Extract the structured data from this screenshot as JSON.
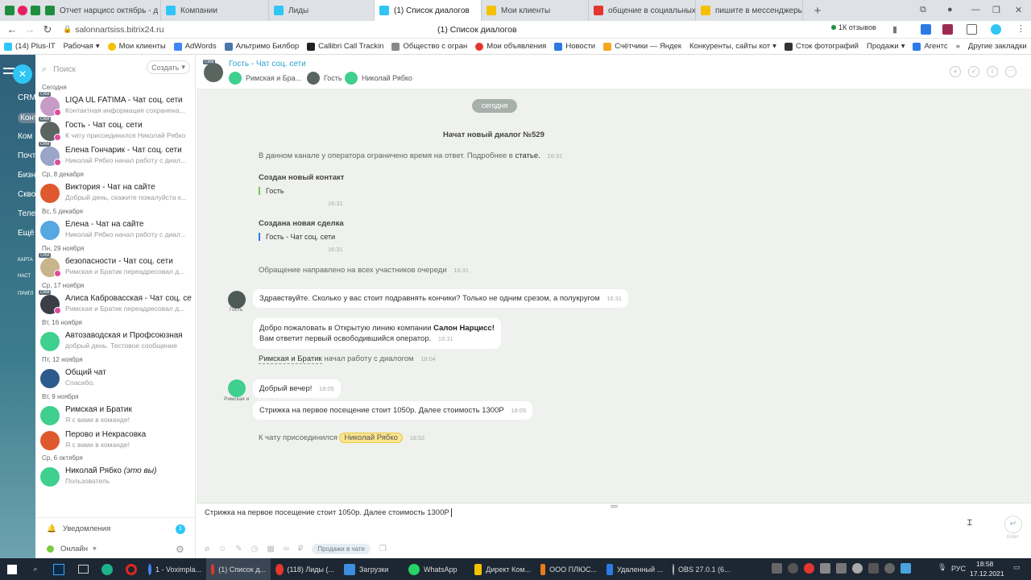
{
  "browser": {
    "tabs": [
      {
        "label": "Отчет нарцисс октябрь - д",
        "color": "#1e8e3e"
      },
      {
        "label": "Компании",
        "color": "#2fc6f6"
      },
      {
        "label": "Лиды",
        "color": "#2fc6f6"
      },
      {
        "label": "(1) Список диалогов",
        "color": "#2fc6f6"
      },
      {
        "label": "Мои клиенты",
        "color": "#f5c000"
      },
      {
        "label": "общение в социальных се",
        "color": "#e4362e"
      },
      {
        "label": "пишите в мессенджеры:",
        "color": "#f5c000"
      }
    ],
    "url": "salonnartsiss.bitrix24.ru",
    "page_title": "(1) Список диалогов",
    "reviews": "1К отзывов",
    "bookmarks": [
      "(14) Plus-IT",
      "Рабочая",
      "Мои клиенты",
      "AdWords",
      "Альтримо Билбор",
      "Callibri Call Trackin",
      "Общество с огран",
      "Мои объявления",
      "Новости",
      "Счётчики — Яндек",
      "Конкуренты, сайты кот",
      "Сток фотографий",
      "Продажи",
      "Агентс"
    ],
    "other_bookmarks": "Другие закладки"
  },
  "leftstrip": [
    "CRM",
    "Конт",
    "Ком",
    "Почт",
    "Бизн",
    "Скво",
    "Теле",
    "Ещё",
    "КАРТА",
    "НАСТ",
    "ПРИГЛ"
  ],
  "sidebar": {
    "search_placeholder": "Поиск",
    "create_label": "Создать",
    "sections": [
      "Сегодня",
      "Ср, 8 декабря",
      "Вс, 5 декабря",
      "Пн, 29 ноября",
      "Ср, 17 ноября",
      "Вт, 16 ноября",
      "Пт, 12 ноября",
      "Вт, 9 ноября",
      "Ср, 6 октября"
    ],
    "chats": [
      {
        "title": "LIQA UL FATIMA - Чат соц. сети",
        "sub": "Контактная информация сохранена..."
      },
      {
        "title": "Гость - Чат соц. сети",
        "sub": "К чату присоединился Николай Рябко"
      },
      {
        "title": "Елена Гончарик - Чат соц. сети",
        "sub": "Николай Рябко начал работу с диал..."
      },
      {
        "title": "Виктория - Чат на сайте",
        "sub": "Добрый день, скажите пожалуйста к..."
      },
      {
        "title": "Елена - Чат на сайте",
        "sub": "Николай Рябко начал работу с диал..."
      },
      {
        "title": "безопасности - Чат соц. сети",
        "sub": "Римская и Братик переадресовал д..."
      },
      {
        "title": "Алиса Кабровасская - Чат соц. сети",
        "sub": "Римская и Братик переадресовал д..."
      },
      {
        "title": "Автозаводская и Профсоюзная",
        "sub": "добрый день. Тестовое сообщение"
      },
      {
        "title": "Общий чат",
        "sub": "Спасибо."
      },
      {
        "title": "Римская и Братик",
        "sub": "Я с вами в команде!"
      },
      {
        "title": "Перово и Некрасовка",
        "sub": "Я с вами в команде!"
      },
      {
        "title": "Николай Рябко",
        "title_em": "(это вы)",
        "sub": "Пользователь"
      }
    ],
    "notifications_label": "Уведомления",
    "notifications_count": "1",
    "status_label": "Онлайн"
  },
  "header": {
    "title": "Гость - Чат соц. сети",
    "participants": [
      "Римская и Бра...",
      "Гость",
      "Николай Рябко"
    ]
  },
  "messages": {
    "date_pill": "сегодня",
    "dialog_started": "Начат новый диалог №529",
    "limit_text": "В данном канале у оператора ограничено время на ответ. Подробнее в",
    "limit_link": "статье.",
    "limit_time": "16:31",
    "new_contact_title": "Создан новый контакт",
    "new_contact_value": "Гость",
    "new_contact_time": "16:31",
    "new_deal_title": "Создана новая сделка",
    "new_deal_value": "Гость - Чат соц. сети",
    "new_deal_time": "16:31",
    "queue_text": "Обращение направлено на всех участников очереди",
    "queue_time": "16:31",
    "guest_label": "Гость",
    "guest_msg": "Здравствуйте. Сколько у вас стоит подравнять кончики? Только не одним срезом, а полукругом",
    "guest_time": "16:31",
    "welcome_prefix": "Добро пожаловать в Открытую линию компании",
    "welcome_company": "Салон Нарцисс!",
    "welcome_line2": "Вам ответит первый освободившийся оператор.",
    "welcome_time": "16:31",
    "op_started_name": "Римская и Братик",
    "op_started_text": "начал работу с диалогом",
    "op_started_time": "18:04",
    "op_label": "Римская и",
    "op_msg1": "Добрый вечер!",
    "op_msg1_time": "18:05",
    "op_msg2": "Стрижка на первое посещение стоит 1050р. Далее стоимость 1300Р",
    "op_msg2_time": "18:05",
    "joined_text": "К чату присоединился",
    "joined_name": "Николай Рябко",
    "joined_time": "18:52"
  },
  "input": {
    "text": "Стрижка на первое посещение стоит 1050р. Далее стоимость 1300Р",
    "sales_tag": "Продажи в чате",
    "enter_label": "Enter"
  },
  "taskbar": {
    "items": [
      "1 - Voximpla...",
      "(1) Список д...",
      "(118) Лиды (...",
      "Загрузки",
      "WhatsApp",
      "Директ Ком...",
      "ООО ПЛЮС...",
      "Удаленный ...",
      "OBS 27.0.1 (6..."
    ],
    "lang": "РУС",
    "time": "18:58",
    "date": "17.12.2021"
  }
}
